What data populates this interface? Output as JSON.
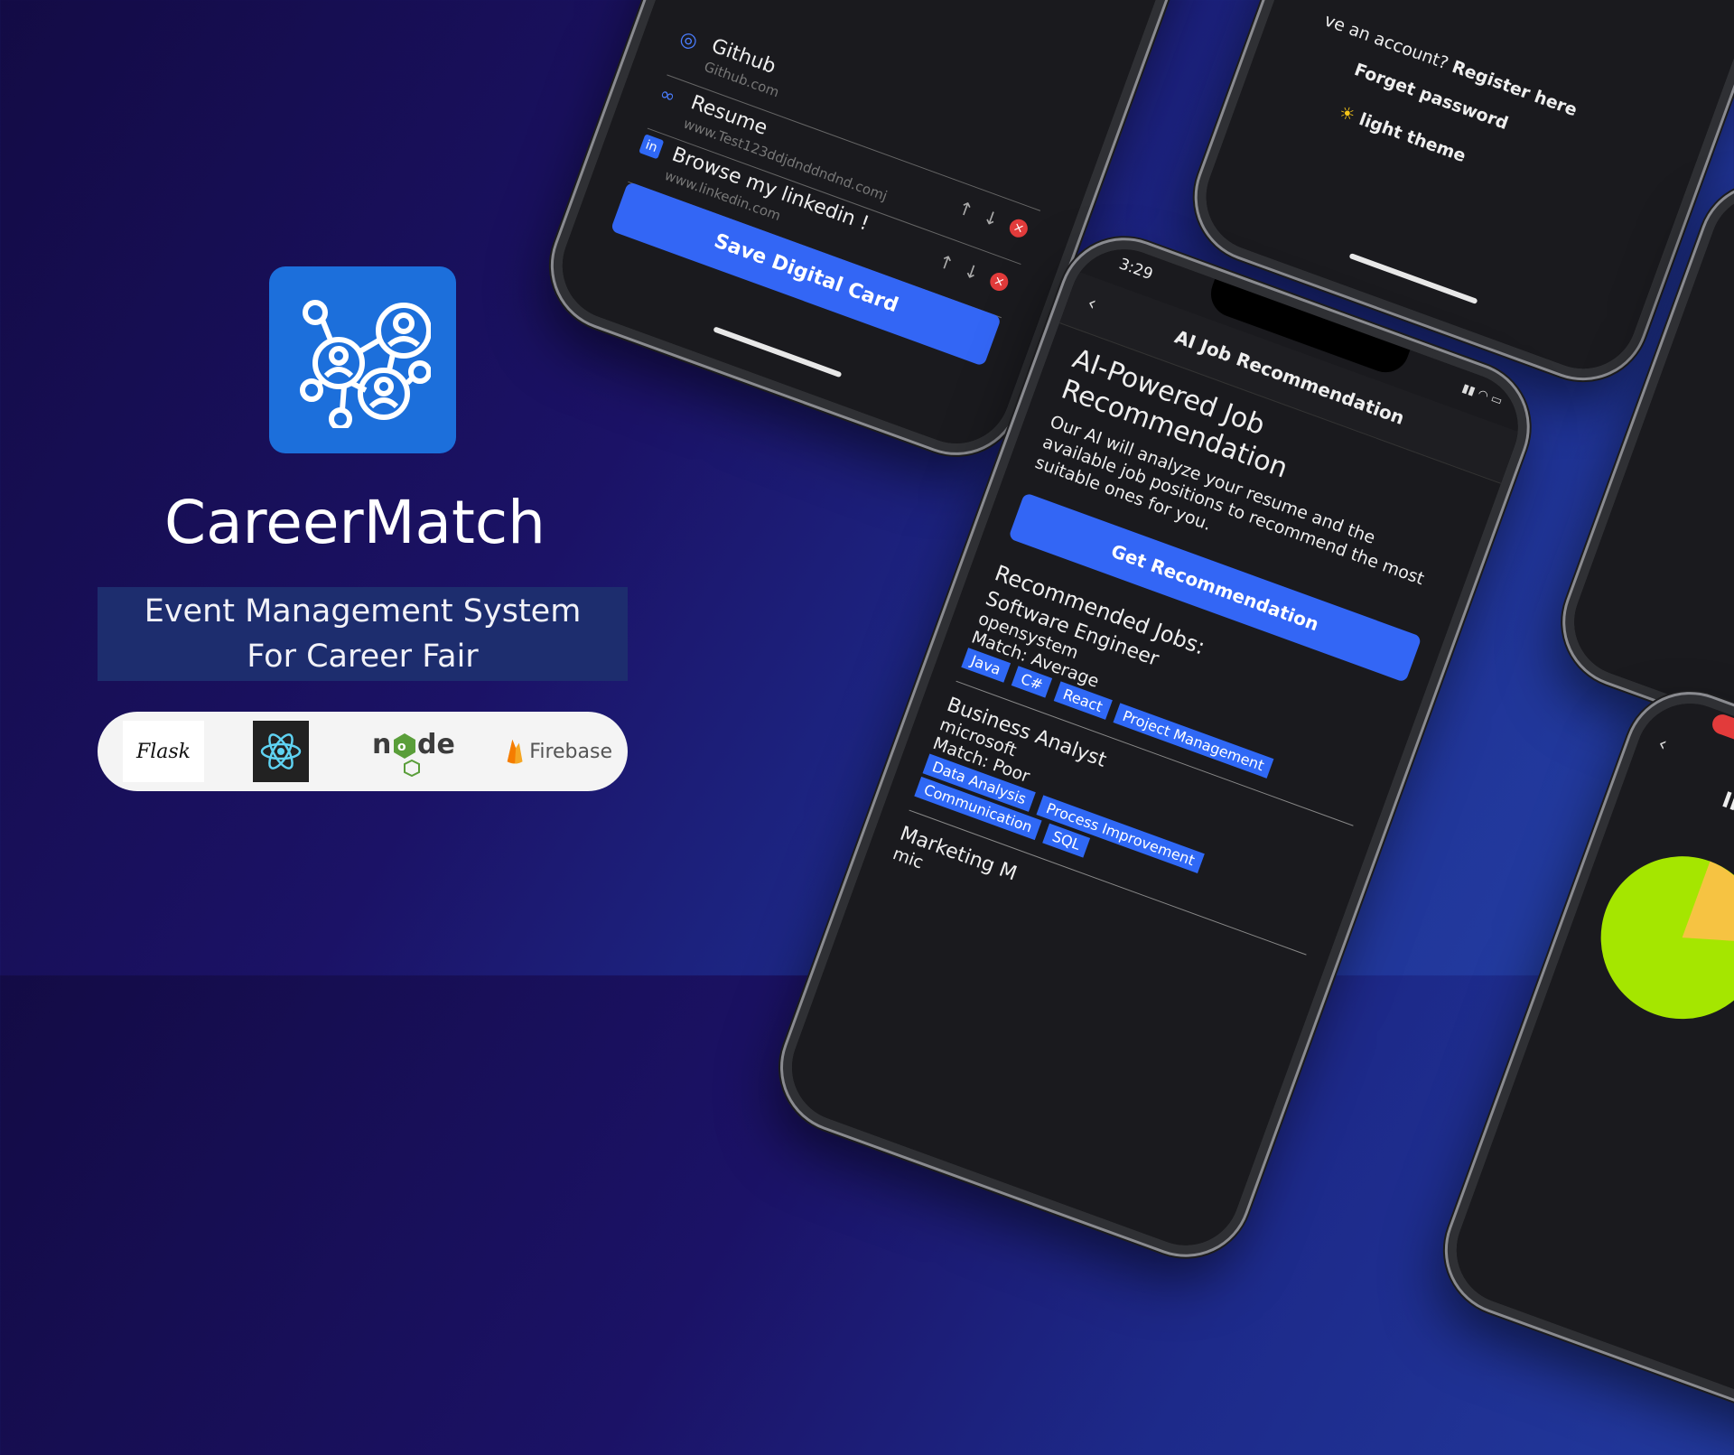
{
  "brand": {
    "name": "CareerMatch",
    "tagline_line1": "Event Management System",
    "tagline_line2": "For Career Fair"
  },
  "tech": {
    "flask": "Flask",
    "firebase": "Firebase"
  },
  "phone1": {
    "links": [
      {
        "title": "Github",
        "url": "Github.com"
      },
      {
        "title": "Resume",
        "url": "www.Test123ddjdnddndnd.comj"
      },
      {
        "title": "Browse my linkedin !",
        "url": "www.linkedin.com"
      }
    ],
    "save_label": "Save Digital Card"
  },
  "phone2": {
    "text1": "ve an account? ",
    "register": "Register here",
    "forget": "Forget password",
    "theme_icon": "☀",
    "theme": "light theme"
  },
  "phone3": {
    "time": "3:29",
    "nav_title": "AI Job Recommendation",
    "heading": "AI-Powered Job Recommendation",
    "desc": "Our AI will analyze your resume and the available job positions to recommend the most suitable ones for you.",
    "button": "Get Recommendation",
    "rec_title": "Recommended Jobs:",
    "jobs": [
      {
        "title": "Software Engineer",
        "company": "opensystem",
        "match": "Match: Average",
        "tags": [
          "Java",
          "C#",
          "React",
          "Project Management"
        ]
      },
      {
        "title": "Business Analyst",
        "company": "microsoft",
        "match": "Match: Poor",
        "tags": [
          "Data Analysis",
          "Process Improvement",
          "Communication",
          "SQL"
        ]
      },
      {
        "title": "Marketing M",
        "company": "mic",
        "match": "",
        "tags": []
      }
    ]
  },
  "phone4": {
    "title": "Intervie"
  }
}
